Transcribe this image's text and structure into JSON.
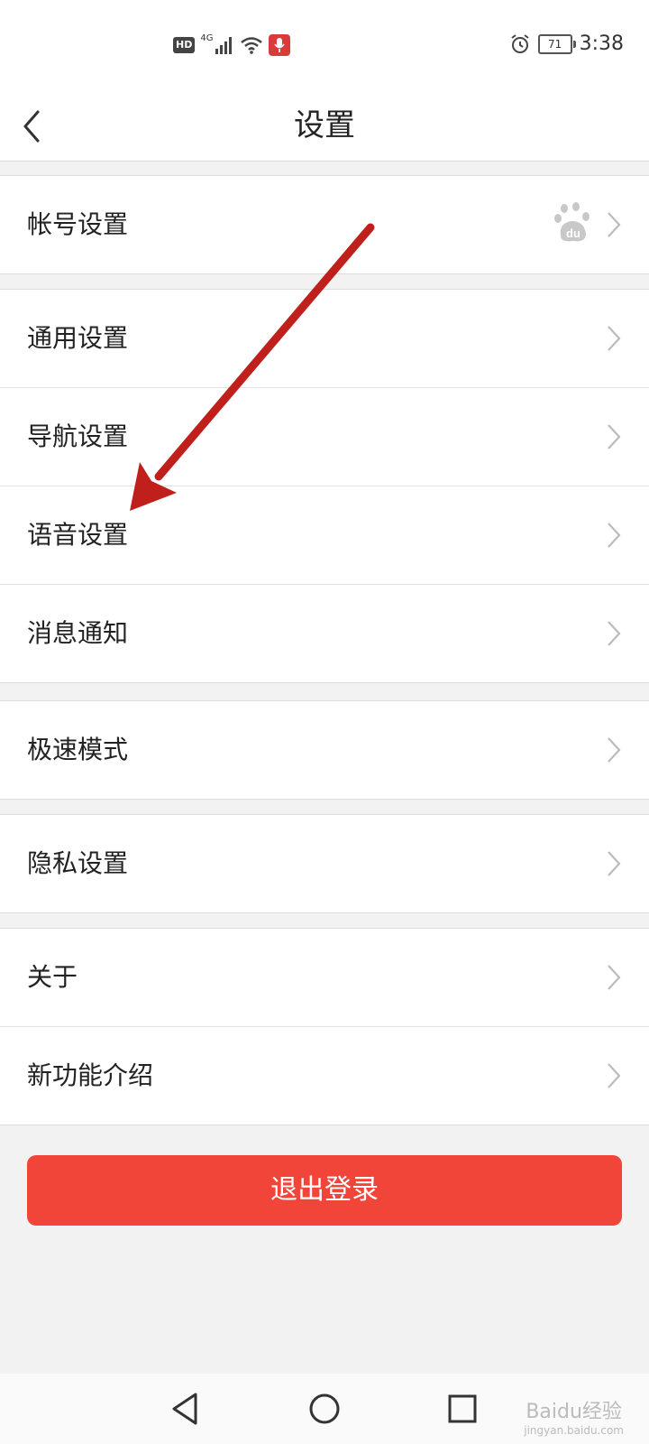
{
  "status_bar": {
    "hd": "HD",
    "network": "4G",
    "battery": "71",
    "time": "3:38"
  },
  "header": {
    "title": "设置"
  },
  "sections": [
    {
      "items": [
        {
          "label": "帐号设置"
        }
      ]
    },
    {
      "items": [
        {
          "label": "通用设置"
        },
        {
          "label": "导航设置"
        },
        {
          "label": "语音设置"
        },
        {
          "label": "消息通知"
        }
      ]
    },
    {
      "items": [
        {
          "label": "极速模式"
        }
      ]
    },
    {
      "items": [
        {
          "label": "隐私设置"
        }
      ]
    },
    {
      "items": [
        {
          "label": "关于"
        },
        {
          "label": "新功能介绍"
        }
      ]
    }
  ],
  "logout": {
    "label": "退出登录"
  },
  "icons": {
    "back": "back-arrow-icon",
    "account_logo": "baidu-paw-icon",
    "row_chevron": "chevron-right-icon",
    "nav_back": "triangle-back-icon",
    "nav_home": "circle-home-icon",
    "nav_recent": "square-recent-icon"
  },
  "colors": {
    "accent": "#f2453a",
    "annotation_arrow": "#c0201c",
    "background": "#f2f2f2"
  },
  "watermark": {
    "text": "Baidu经验",
    "sub": "jingyan.baidu.com"
  }
}
